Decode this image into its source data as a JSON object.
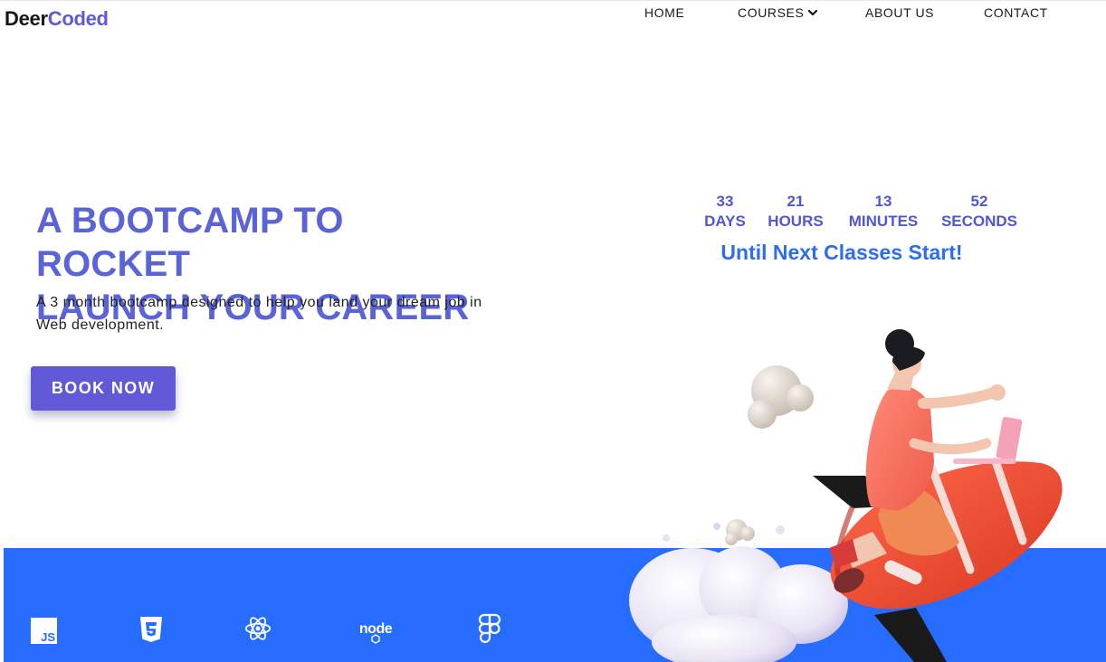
{
  "brand": {
    "part1": "Deer",
    "part2": "Coded"
  },
  "nav": {
    "home": "HOME",
    "courses": "COURSES",
    "about": "ABOUT US",
    "contact": "CONTACT"
  },
  "hero": {
    "title_line1": "A BOOTCAMP TO ROCKET",
    "title_line2": "LAUNCH YOUR CAREER",
    "subtitle": "A 3 month bootcamp designed to help you land your dream job in Web development.",
    "cta": "BOOK NOW"
  },
  "countdown": {
    "days": {
      "value": "33",
      "label": "DAYS"
    },
    "hours": {
      "value": "21",
      "label": "HOURS"
    },
    "minutes": {
      "value": "13",
      "label": "MINUTES"
    },
    "seconds": {
      "value": "52",
      "label": "SECONDS"
    },
    "caption": "Until Next Classes Start!"
  },
  "tech_icons": [
    "javascript-icon",
    "css3-icon",
    "react-icon",
    "nodejs-icon",
    "figma-icon"
  ],
  "colors": {
    "brand_accent": "#5b5bd6",
    "headline": "#5a63d8",
    "button": "#6259d8",
    "band": "#256cff",
    "caption": "#2d6df0"
  }
}
